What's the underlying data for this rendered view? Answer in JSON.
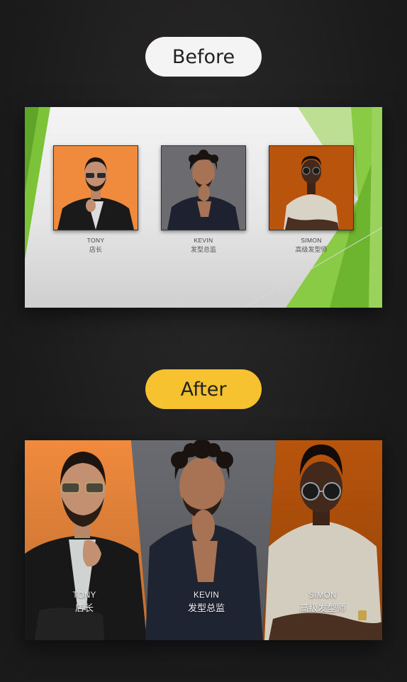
{
  "labels": {
    "before": "Before",
    "after": "After"
  },
  "people": [
    {
      "name": "TONY",
      "role": "店长"
    },
    {
      "name": "KEVIN",
      "role": "发型总监"
    },
    {
      "name": "SIMON",
      "role": "高级发型师"
    }
  ],
  "colors": {
    "after_pill": "#f7c22f",
    "before_pill": "#f4f4f4",
    "green_accent": "#7cc33a",
    "orange_bg": "#f0873a",
    "dark_orange_bg": "#b8540c",
    "grey_bg": "#6c6c70"
  }
}
